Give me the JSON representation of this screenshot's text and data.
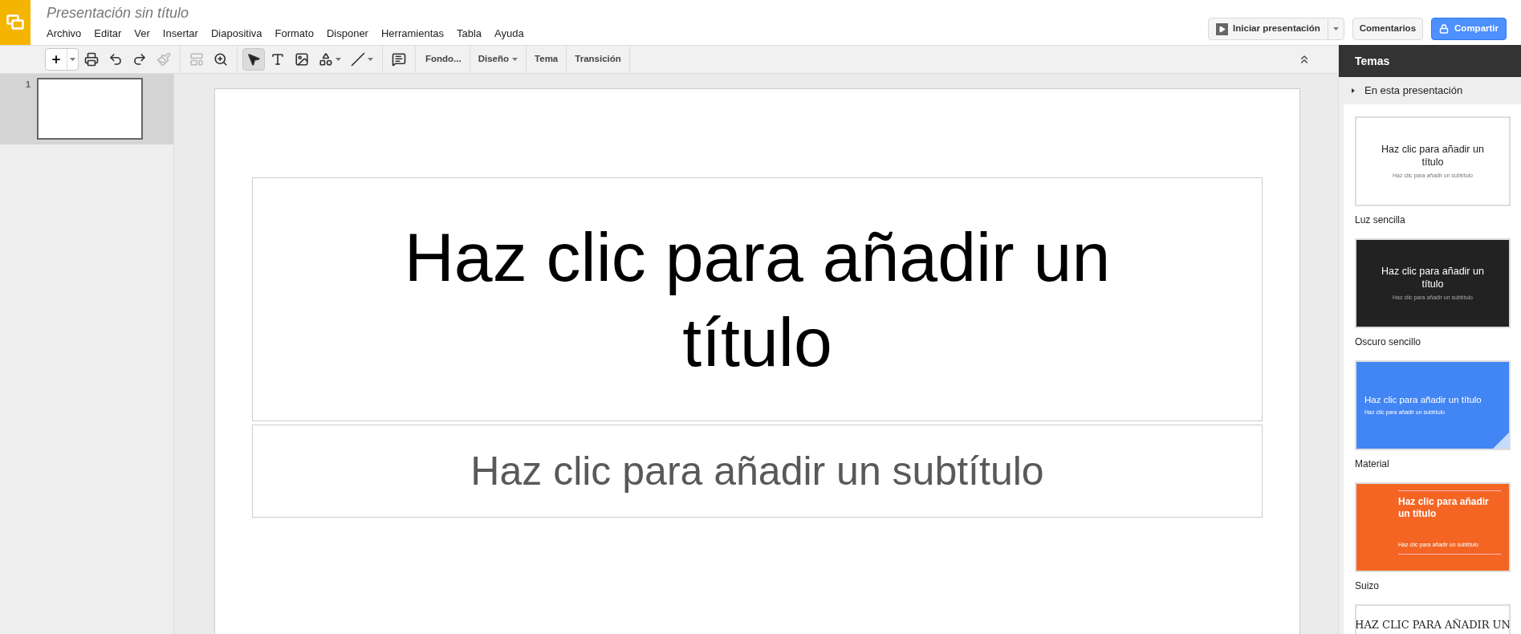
{
  "document": {
    "title": "Presentación sin título"
  },
  "menu": [
    "Archivo",
    "Editar",
    "Ver",
    "Insertar",
    "Diapositiva",
    "Formato",
    "Disponer",
    "Herramientas",
    "Tabla",
    "Ayuda"
  ],
  "header_buttons": {
    "present": "Iniciar presentación",
    "comments": "Comentarios",
    "share": "Compartir"
  },
  "toolbar": {
    "tools": [
      {
        "kind": "new",
        "selected": false
      },
      {
        "kind": "print",
        "selected": false
      },
      {
        "kind": "undo",
        "selected": false
      },
      {
        "kind": "redo",
        "selected": false
      },
      {
        "kind": "paint",
        "selected": false
      },
      {
        "kind": "layout",
        "selected": false
      },
      {
        "kind": "zoom",
        "selected": false
      },
      {
        "kind": "select",
        "selected": true
      },
      {
        "kind": "textbox",
        "selected": false
      },
      {
        "kind": "image",
        "selected": false
      },
      {
        "kind": "shape",
        "selected": false
      },
      {
        "kind": "line",
        "selected": false
      },
      {
        "kind": "comment",
        "selected": false
      }
    ],
    "text_buttons": [
      {
        "label": "Fondo...",
        "dropdown": false
      },
      {
        "label": "Diseño",
        "dropdown": true
      },
      {
        "label": "Tema",
        "dropdown": false
      },
      {
        "label": "Transición",
        "dropdown": false
      }
    ]
  },
  "filmstrip": [
    {
      "number": "1",
      "selected": true
    }
  ],
  "slide": {
    "title_placeholder": "Haz clic para añadir un título",
    "subtitle_placeholder": "Haz clic para añadir un subtítulo"
  },
  "themes_panel": {
    "title": "Temas",
    "section": "En esta presentación",
    "themes": [
      {
        "kind": "light",
        "name": "Luz sencilla",
        "title": "Haz clic para añadir un título",
        "subtitle": "Haz clic para añadir un subtítulo"
      },
      {
        "kind": "dark",
        "name": "Oscuro sencillo",
        "title": "Haz clic para añadir un título",
        "subtitle": "Haz clic para añadir un subtítulo"
      },
      {
        "kind": "material",
        "name": "Material",
        "title": "Haz clic para añadir un título",
        "subtitle": "Haz clic para añadir un subtítulo"
      },
      {
        "kind": "swiss",
        "name": "Suizo",
        "title": "Haz clic para añadir un título",
        "subtitle": "Haz clic para añadir un subtítulo"
      },
      {
        "kind": "hand",
        "title": "HAZ CLIC PARA AÑADIR UN"
      }
    ]
  }
}
